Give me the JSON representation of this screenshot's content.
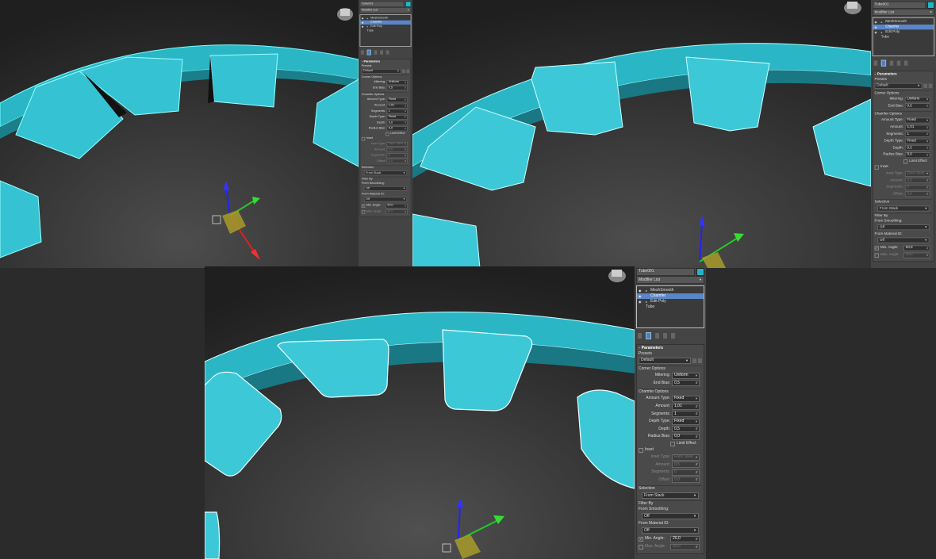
{
  "colors": {
    "accent": "#1fb6c9",
    "selection": "#5a86c9",
    "mesh": "#2ec4d6"
  },
  "panels": [
    {
      "object_name": "Tube001",
      "modifier_list": "Modifier List",
      "stack": [
        {
          "label": "MeshSmooth",
          "selected": false
        },
        {
          "label": "Chamfer",
          "selected": true
        },
        {
          "label": "Edit Poly",
          "selected": false
        },
        {
          "label": "Tube",
          "selected": false
        }
      ],
      "rollout_title": "Parameters",
      "presets_label": "Presets",
      "preset_value": "Default",
      "corner_options": "Corner Options",
      "mitering_label": "Mitering:",
      "mitering_value": "Uniform",
      "end_bias_label": "End Bias:",
      "end_bias_value": "0,5",
      "chamfer_options": "Chamfer Options",
      "amount_type_label": "Amount Type:",
      "amount_type_value": "Fixed",
      "amount_label": "Amount:",
      "amount_value": "1,01",
      "segments_label": "Segments:",
      "segments_value": "1",
      "depth_type_label": "Depth Type:",
      "depth_type_value": "Fixed",
      "depth_label": "Depth:",
      "depth_value": "0,0",
      "radius_bias_label": "Radius Bias:",
      "radius_bias_value": "0,0",
      "limit_effect": "Limit Effect",
      "inset": "Inset",
      "inset_type_label": "Inset Type:",
      "inset_type_value": "Face Steel",
      "inset_amount_label": "Amount:",
      "inset_amount_value": "0,5",
      "inset_segments_label": "Segments:",
      "inset_segments_value": "0",
      "offset_label": "Offset:",
      "offset_value": "0,0",
      "selection": "Selection",
      "selection_value": "From Stack",
      "filter_by": "Filter By",
      "from_smoothing": "From Smoothing:",
      "smoothing_value": "Off",
      "from_material_id": "From Material ID:",
      "material_value": "Off",
      "min_angle_label": "Min. Angle:",
      "min_angle_value": "20,0",
      "max_angle_label": "Max. Angle:",
      "max_angle_value": "30,0"
    },
    {
      "object_name": "Tube001",
      "modifier_list": "Modifier List",
      "stack": [
        {
          "label": "MeshSmooth",
          "selected": false
        },
        {
          "label": "Chamfer",
          "selected": true
        },
        {
          "label": "Edit Poly",
          "selected": false
        },
        {
          "label": "Tube",
          "selected": false
        }
      ],
      "rollout_title": "Parameters",
      "presets_label": "Presets",
      "preset_value": "Default",
      "corner_options": "Corner Options",
      "mitering_label": "Mitering:",
      "mitering_value": "Uniform",
      "end_bias_label": "End Bias:",
      "end_bias_value": "0,5",
      "chamfer_options": "Chamfer Options",
      "amount_type_label": "Amount Type:",
      "amount_type_value": "Fixed",
      "amount_label": "Amount:",
      "amount_value": "1,01",
      "segments_label": "Segments:",
      "segments_value": "1",
      "depth_type_label": "Depth Type:",
      "depth_type_value": "Fixed",
      "depth_label": "Depth:",
      "depth_value": "0,5",
      "radius_bias_label": "Radius Bias:",
      "radius_bias_value": "0,0",
      "limit_effect": "Limit Effect",
      "inset": "Inset",
      "inset_type_label": "Inset Type:",
      "inset_type_value": "Face Steel",
      "inset_amount_label": "Amount:",
      "inset_amount_value": "0,5",
      "inset_segments_label": "Segments:",
      "inset_segments_value": "0",
      "offset_label": "Offset:",
      "offset_value": "0,0",
      "selection": "Selection",
      "selection_value": "From Stack",
      "filter_by": "Filter By",
      "from_smoothing": "From Smoothing:",
      "smoothing_value": "Off",
      "from_material_id": "From Material ID:",
      "material_value": "Off",
      "min_angle_label": "Min. Angle:",
      "min_angle_value": "20,0",
      "max_angle_label": "Max. Angle:",
      "max_angle_value": "30,0"
    },
    {
      "object_name": "Tube001",
      "modifier_list": "Modifier List",
      "stack": [
        {
          "label": "MeshSmooth",
          "selected": false
        },
        {
          "label": "Chamfer",
          "selected": true
        },
        {
          "label": "Edit Poly",
          "selected": false
        },
        {
          "label": "Tube",
          "selected": false
        }
      ],
      "rollout_title": "Parameters",
      "presets_label": "Presets",
      "preset_value": "Default",
      "corner_options": "Corner Options",
      "mitering_label": "Mitering:",
      "mitering_value": "Uniform",
      "end_bias_label": "End Bias:",
      "end_bias_value": "0,5",
      "chamfer_options": "Chamfer Options",
      "amount_type_label": "Amount Type:",
      "amount_type_value": "Fixed",
      "amount_label": "Amount:",
      "amount_value": "1,01",
      "segments_label": "Segments:",
      "segments_value": "1",
      "depth_type_label": "Depth Type:",
      "depth_type_value": "Fixed",
      "depth_label": "Depth:",
      "depth_value": "0,5",
      "radius_bias_label": "Radius Bias:",
      "radius_bias_value": "0,0",
      "limit_effect": "Limit Effect",
      "inset": "Inset",
      "inset_type_label": "Inset Type:",
      "inset_type_value": "Face Steel",
      "inset_amount_label": "Amount:",
      "inset_amount_value": "0,5",
      "inset_segments_label": "Segments:",
      "inset_segments_value": "0",
      "offset_label": "Offset:",
      "offset_value": "0,0",
      "selection": "Selection",
      "selection_value": "From Stack",
      "filter_by": "Filter By",
      "from_smoothing": "From Smoothing:",
      "smoothing_value": "Off",
      "from_material_id": "From Material ID:",
      "material_value": "Off",
      "min_angle_label": "Min. Angle:",
      "min_angle_value": "20,0",
      "max_angle_label": "Max. Angle:",
      "max_angle_value": "30,0"
    }
  ]
}
